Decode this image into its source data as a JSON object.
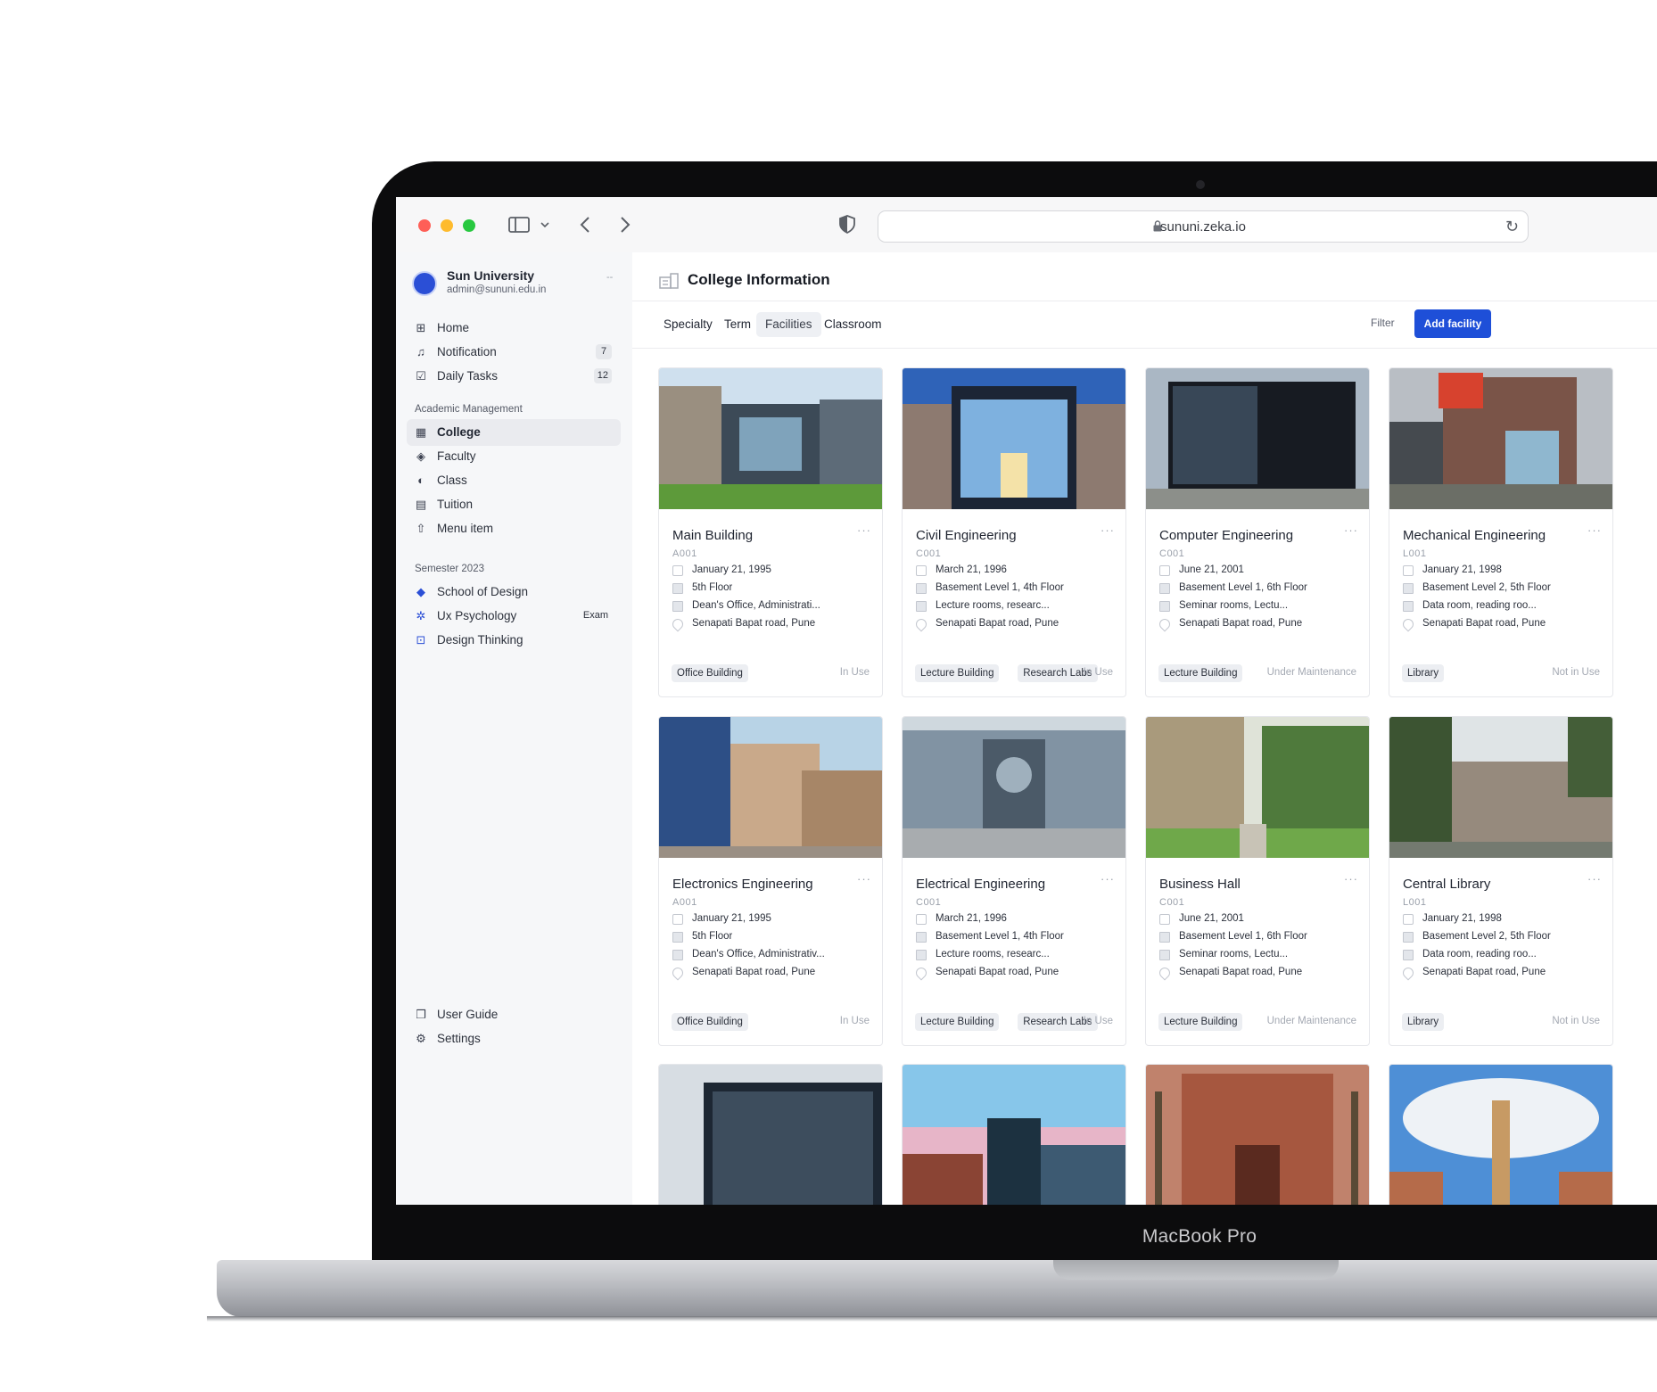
{
  "device_label": "MacBook Pro",
  "browser": {
    "url": "sununi.zeka.io"
  },
  "sidebar": {
    "org_name": "Sun University",
    "org_email": "admin@sununi.edu.in",
    "org_more": "--",
    "top_items": [
      {
        "label": "Home",
        "icon": "grid-icon"
      },
      {
        "label": "Notification",
        "icon": "bell-icon",
        "badge": "7"
      },
      {
        "label": "Daily Tasks",
        "icon": "checkbox-icon",
        "badge": "12"
      }
    ],
    "academic_section": "Academic Management",
    "academic_items": [
      {
        "label": "College",
        "icon": "building-icon",
        "active": true
      },
      {
        "label": "Faculty",
        "icon": "graduation-cap-icon"
      },
      {
        "label": "Class",
        "icon": "palette-icon"
      },
      {
        "label": "Tuition",
        "icon": "receipt-icon"
      },
      {
        "label": "Menu item",
        "icon": "share-icon"
      }
    ],
    "semester_section": "Semester 2023",
    "semester_items": [
      {
        "label": "School of Design",
        "icon": "design-square-icon"
      },
      {
        "label": "Ux Psychology",
        "icon": "sparkle-icon",
        "badge": "Exam"
      },
      {
        "label": "Design Thinking",
        "icon": "grid-square-icon"
      }
    ],
    "bottom_items": [
      {
        "label": "User Guide",
        "icon": "book-icon"
      },
      {
        "label": "Settings",
        "icon": "gear-icon"
      }
    ]
  },
  "main": {
    "title": "College Information",
    "tabs": [
      "Specialty",
      "Term",
      "Facilities",
      "Classroom"
    ],
    "active_tab": "Facilities",
    "filter_label": "Filter",
    "add_button_label": "Add facility"
  },
  "cards": [
    {
      "title": "Main Building",
      "code": "A001",
      "date": "January 21, 1995",
      "floor": "5th Floor",
      "rooms": "Dean's Office, Administrati...",
      "address": "Senapati Bapat road, Pune",
      "tags": [
        "Office Building"
      ],
      "status": "In Use",
      "image": "glass-campus-building"
    },
    {
      "title": "Civil Engineering",
      "code": "C001",
      "date": "March 21, 1996",
      "floor": "Basement Level 1, 4th Floor",
      "rooms": "Lecture rooms, researc...",
      "address": "Senapati Bapat road, Pune",
      "tags": [
        "Lecture Building",
        "Research Labs"
      ],
      "status": "In Use",
      "image": "glass-facade-night"
    },
    {
      "title": "Computer Engineering",
      "code": "C001",
      "date": "June 21, 2001",
      "floor": "Basement Level 1, 6th Floor",
      "rooms": "Seminar rooms, Lectu...",
      "address": "Senapati Bapat road, Pune",
      "tags": [
        "Lecture Building"
      ],
      "status": "Under Maintenance",
      "image": "black-glass-cube"
    },
    {
      "title": "Mechanical Engineering",
      "code": "L001",
      "date": "January 21, 1998",
      "floor": "Basement Level 2, 5th Floor",
      "rooms": "Data room, reading roo...",
      "address": "Senapati Bapat road, Pune",
      "tags": [
        "Library"
      ],
      "status": "Not in Use",
      "image": "brick-modern-building"
    },
    {
      "title": "Electronics Engineering",
      "code": "A001",
      "date": "January 21, 1995",
      "floor": "5th Floor",
      "rooms": "Dean's Office, Administrativ...",
      "address": "Senapati Bapat road, Pune",
      "tags": [
        "Office Building"
      ],
      "status": "In Use",
      "image": "blue-tan-blocks"
    },
    {
      "title": "Electrical Engineering",
      "code": "C001",
      "date": "March 21, 1996",
      "floor": "Basement Level 1, 4th Floor",
      "rooms": "Lecture rooms, researc...",
      "address": "Senapati Bapat road, Pune",
      "tags": [
        "Lecture Building",
        "Research Labs"
      ],
      "status": "In Use",
      "image": "steel-atrium"
    },
    {
      "title": "Business Hall",
      "code": "C001",
      "date": "June 21, 2001",
      "floor": "Basement Level 1, 6th Floor",
      "rooms": "Seminar rooms, Lectu...",
      "address": "Senapati Bapat road, Pune",
      "tags": [
        "Lecture Building"
      ],
      "status": "Under Maintenance",
      "image": "gothic-hall-lawn"
    },
    {
      "title": "Central Library",
      "code": "L001",
      "date": "January 21, 1998",
      "floor": "Basement Level 2, 5th Floor",
      "rooms": "Data room, reading roo...",
      "address": "Senapati Bapat road, Pune",
      "tags": [
        "Library"
      ],
      "status": "Not in Use",
      "image": "stone-library-trees"
    }
  ],
  "partial_images": [
    "dark-grid-tower",
    "pink-sky-tower",
    "red-brick-palms",
    "spire-clouds"
  ],
  "colors": {
    "accent": "#1e4fd8",
    "sidebar_bg": "#f6f7f9",
    "bezel": "#0c0c0d"
  }
}
